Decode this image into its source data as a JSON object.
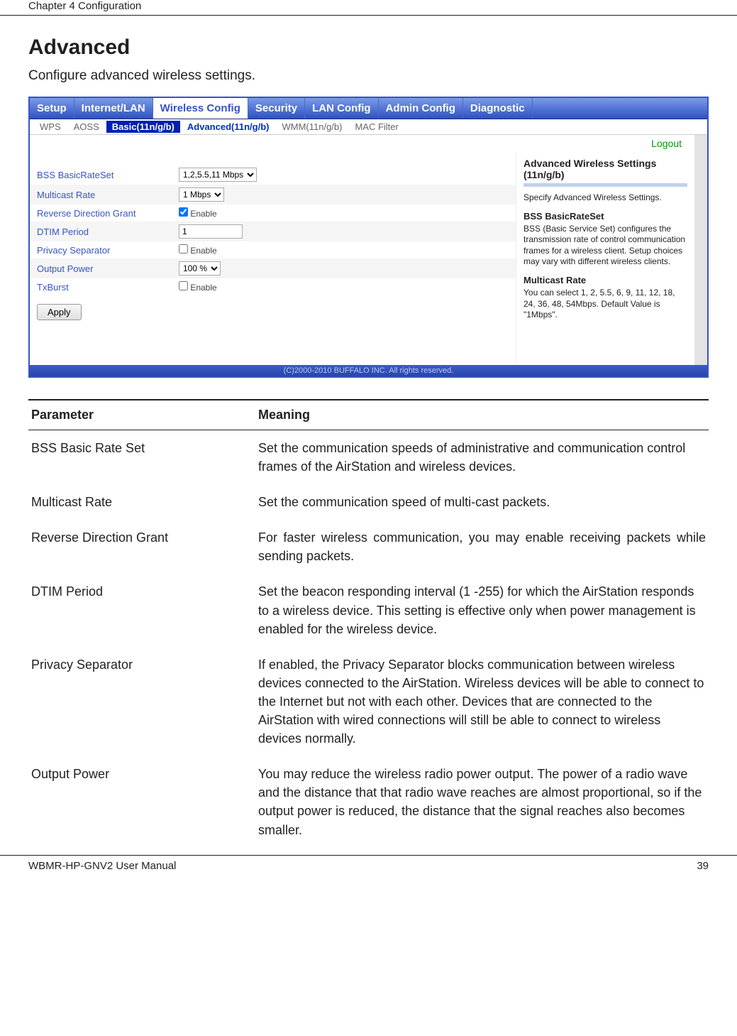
{
  "header": {
    "chapter": "Chapter 4  Configuration"
  },
  "section": {
    "title": "Advanced",
    "description": "Configure advanced wireless settings."
  },
  "screenshot": {
    "main_tabs": [
      "Setup",
      "Internet/LAN",
      "Wireless Config",
      "Security",
      "LAN Config",
      "Admin Config",
      "Diagnostic"
    ],
    "main_active_index": 2,
    "sub_tabs": [
      "WPS",
      "AOSS",
      "Basic(11n/g/b)",
      "Advanced(11n/g/b)",
      "WMM(11n/g/b)",
      "MAC Filter"
    ],
    "sub_active_index": 2,
    "sub_bold_index": 3,
    "logout": "Logout",
    "form": {
      "rows": [
        {
          "label": "BSS BasicRateSet",
          "type": "select",
          "value": "1,2,5.5,11 Mbps"
        },
        {
          "label": "Multicast Rate",
          "type": "select",
          "value": "1 Mbps"
        },
        {
          "label": "Reverse Direction Grant",
          "type": "checkbox",
          "checked": true,
          "text": "Enable"
        },
        {
          "label": "DTIM Period",
          "type": "input",
          "value": "1"
        },
        {
          "label": "Privacy Separator",
          "type": "checkbox",
          "checked": false,
          "text": "Enable"
        },
        {
          "label": "Output Power",
          "type": "select",
          "value": "100 %"
        },
        {
          "label": "TxBurst",
          "type": "checkbox",
          "checked": false,
          "text": "Enable"
        }
      ],
      "apply": "Apply"
    },
    "info_panel": {
      "title": "Advanced Wireless Settings (11n/g/b)",
      "intro": "Specify Advanced Wireless Settings.",
      "sections": [
        {
          "heading": "BSS BasicRateSet",
          "body": "BSS (Basic Service Set) configures the transmission rate of control communication frames for a wireless client. Setup choices may vary with different wireless clients."
        },
        {
          "heading": "Multicast Rate",
          "body": "You can select 1, 2, 5.5, 6, 9, 11, 12, 18, 24, 36, 48, 54Mbps. Default Value is \"1Mbps\"."
        }
      ]
    },
    "copyright": "(C)2000-2010 BUFFALO INC. All rights reserved."
  },
  "param_table": {
    "headers": [
      "Parameter",
      "Meaning"
    ],
    "rows": [
      {
        "p": "BSS Basic Rate Set",
        "m": "Set the communication speeds of administrative and communication control frames of the AirStation and wireless devices.",
        "justify": false
      },
      {
        "p": "Multicast Rate",
        "m": "Set the communication speed of multi-cast packets.",
        "justify": false
      },
      {
        "p": "Reverse Direction Grant",
        "m": "For faster wireless communication, you may enable receiving packets while sending packets.",
        "justify": true
      },
      {
        "p": "DTIM Period",
        "m": "Set the beacon responding interval (1 -255) for which the AirStation responds to a wireless device. This setting is effective only when power management is enabled for the wireless device.",
        "justify": false
      },
      {
        "p": "Privacy Separator",
        "m": "If enabled, the Privacy Separator blocks communication between wireless devices connected to the AirStation. Wireless devices will be able to connect to the Internet but not with each other. Devices that are connected to the AirStation with wired connections will still be able to connect to wireless devices normally.",
        "justify": false
      },
      {
        "p": "Output Power",
        "m": "You may reduce the wireless radio power output. The power of a radio wave and the distance that that radio wave reaches are almost proportional, so if the output power is reduced, the distance that the signal reaches also becomes smaller.",
        "justify": false
      }
    ]
  },
  "footer": {
    "left": "WBMR-HP-GNV2 User Manual",
    "right": "39"
  }
}
